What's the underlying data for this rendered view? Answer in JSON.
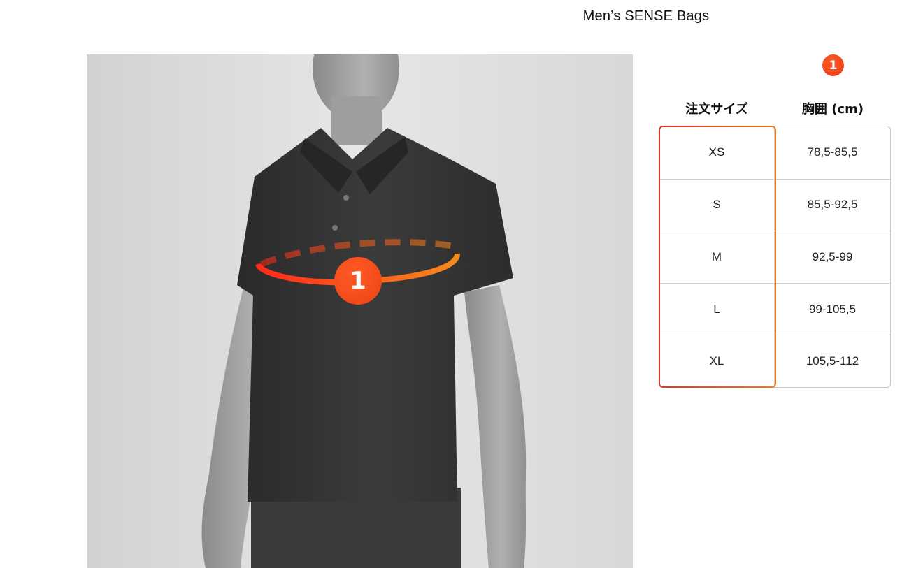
{
  "page": {
    "title": "Men’s SENSE Bags"
  },
  "figure": {
    "marker_label": "1"
  },
  "legend": {
    "badge_label": "1"
  },
  "table": {
    "headers": {
      "size": "注文サイズ",
      "chest": "胸囲 (cm)"
    },
    "rows": [
      {
        "size": "XS",
        "chest": "78,5-85,5"
      },
      {
        "size": "S",
        "chest": "85,5-92,5"
      },
      {
        "size": "M",
        "chest": "92,5-99"
      },
      {
        "size": "L",
        "chest": "99-105,5"
      },
      {
        "size": "XL",
        "chest": "105,5-112"
      }
    ]
  },
  "colors": {
    "accent_start": "#e63422",
    "accent_end": "#f07a1a"
  }
}
